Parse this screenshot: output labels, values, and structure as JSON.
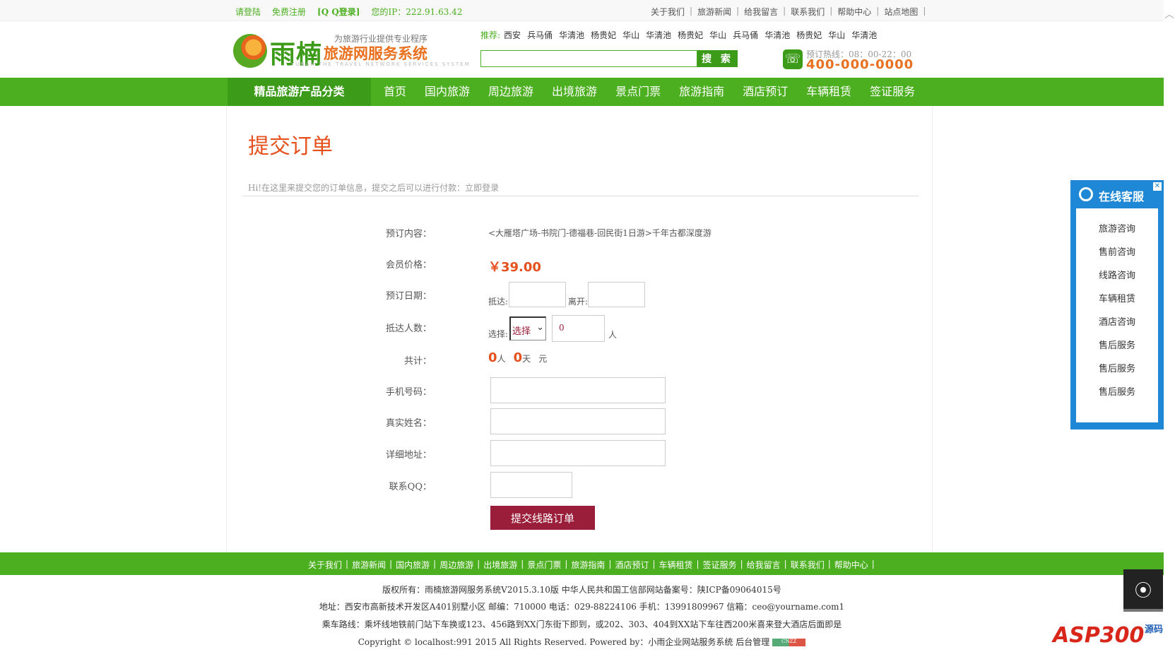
{
  "topbar": {
    "login": "请登陆",
    "register": "免费注册",
    "qq_login": "[Q Q登录]",
    "ip": "您的IP：222.91.63.42",
    "links": [
      "关于我们",
      "旅游新闻",
      "给我留言",
      "联系我们",
      "帮助中心",
      "站点地图"
    ]
  },
  "logo": {
    "name": "雨楠",
    "tagline": "为旅游行业提供专业程序",
    "system": "旅游网服务系统",
    "english": "YUNAN THE TRAVEL NETWORK SERVICES SYSTEM"
  },
  "recommend": {
    "label": "推荐:",
    "items": [
      "西安",
      "兵马俑",
      "华清池",
      "杨贵妃",
      "华山",
      "华清池",
      "杨贵妃",
      "华山",
      "兵马俑",
      "华清池",
      "杨贵妃",
      "华山",
      "华清池"
    ]
  },
  "search": {
    "placeholder": "",
    "button": "搜 索"
  },
  "hotline": {
    "hours": "预订热线：08：00-22：00",
    "number": "400-000-0000"
  },
  "nav": {
    "category": "精品旅游产品分类",
    "items": [
      "首页",
      "国内旅游",
      "周边旅游",
      "出境旅游",
      "景点门票",
      "旅游指南",
      "酒店预订",
      "车辆租赁",
      "签证服务"
    ]
  },
  "order": {
    "title": "提交订单",
    "hint": "Hi!在这里来提交您的订单信息，提交之后可以进行付款：立即登录",
    "labels": {
      "content": "预订内容：",
      "price": "会员价格：",
      "date": "预订日期：",
      "people": "抵达人数：",
      "total": "共计：",
      "phone": "手机号码：",
      "name": "真实姓名：",
      "address": "详细地址：",
      "qq": "联系QQ："
    },
    "content_value": "<大雁塔广场-书院门-德福巷-回民街1日游>千年古都深度游",
    "price_value": "￥39.00",
    "arrive_label": "抵达:",
    "leave_label": "离开:",
    "select_label": "选择:",
    "select_value": "选择",
    "qty_value": "0",
    "person_unit": "人",
    "total_people": "0",
    "total_people_unit": "人",
    "total_days": "0",
    "total_days_unit": "天",
    "yuan": "元",
    "submit": "提交线路订单"
  },
  "service": {
    "title": "在线客服",
    "items": [
      "旅游咨询",
      "售前咨询",
      "线路咨询",
      "车辆租赁",
      "酒店咨询",
      "售后服务",
      "售后服务",
      "售后服务"
    ]
  },
  "footer": {
    "links": [
      "关于我们",
      "旅游新闻",
      "国内旅游",
      "周边旅游",
      "出境旅游",
      "景点门票",
      "旅游指南",
      "酒店预订",
      "车辆租赁",
      "签证服务",
      "给我留言",
      "联系我们",
      "帮助中心"
    ],
    "copyright_line": "版权所有：雨楠旅游网服务系统V2015.3.10版  中华人民共和国工信部网站备案号：陕ICP备09064015号",
    "address_line": "地址：西安市高新技术开发区A401别墅小区  邮编：710000  电话：029-88224106  手机：13991809967  信箱：ceo@yourname.com1",
    "route_line": "乘车路线：乘坏线地铁前门站下车换或123、456路到XX门东街下即到，或202、303、404到XX站下车往西200米喜来登大酒店后面即是",
    "powered_line": "Copyright © localhost:991 2015 All Rights Reserved. Powered by：小雨企业网站服务系统  后台管理",
    "cnzz": "CNZZ"
  },
  "watermark": {
    "main": "ASP300",
    "sub": "源码"
  },
  "colors": {
    "green": "#4caf1f",
    "dark_green": "#3d9b1a",
    "orange": "#e5501c",
    "maroon": "#9a1d3a",
    "blue": "#1f88d6"
  }
}
